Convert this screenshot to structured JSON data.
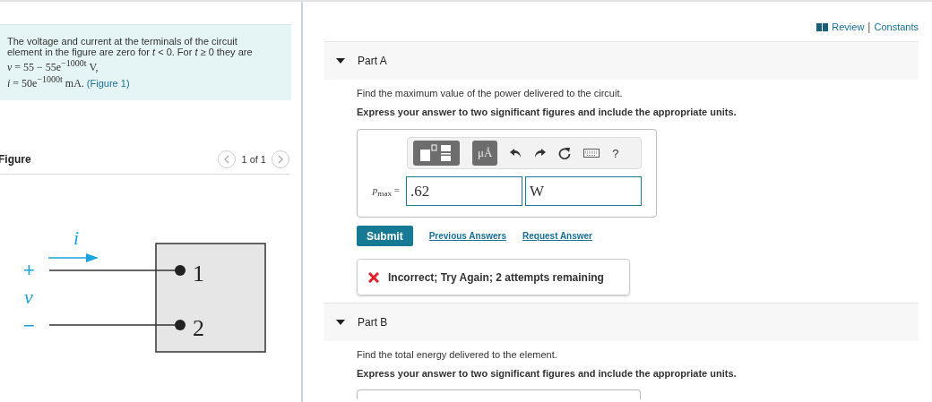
{
  "problem": {
    "text": "The voltage and current at the terminals of the circuit element in the figure are zero for *t* < 0. For *t* ≥ 0 they are",
    "equations": [
      "*v* = 55 − 55e$^{−1000t}$ V,",
      "*i* = 50e$^{−1000t}$ mA."
    ],
    "figure_link": "(Figure 1)"
  },
  "figure": {
    "title": "Figure",
    "pager": "1 of 1",
    "current_label": "i",
    "plus": "+",
    "voltage_label": "v",
    "minus": "−",
    "terminals": [
      "1",
      "2"
    ]
  },
  "header_links": {
    "review": "Review",
    "separator": "|",
    "constants": "Constants"
  },
  "parts": [
    {
      "title": "Part A",
      "expanded": true,
      "prompt": "Find the maximum value of the power delivered to the circuit.",
      "instruction": "Express your answer to two significant figures and include the appropriate units.",
      "answer": {
        "variable": "*p*$_{max}$ =",
        "value": ".62",
        "units": "W",
        "units_button": "μÅ",
        "help": "?"
      },
      "submit": "Submit",
      "links": [
        "Previous Answers",
        "Request Answer"
      ],
      "feedback": {
        "kind": "incorrect",
        "text": "Incorrect; Try Again; 2 attempts remaining"
      }
    },
    {
      "title": "Part B",
      "expanded": true,
      "prompt": "Find the total energy delivered to the element.",
      "instruction": "Express your answer to two significant figures and include the appropriate units."
    }
  ]
}
